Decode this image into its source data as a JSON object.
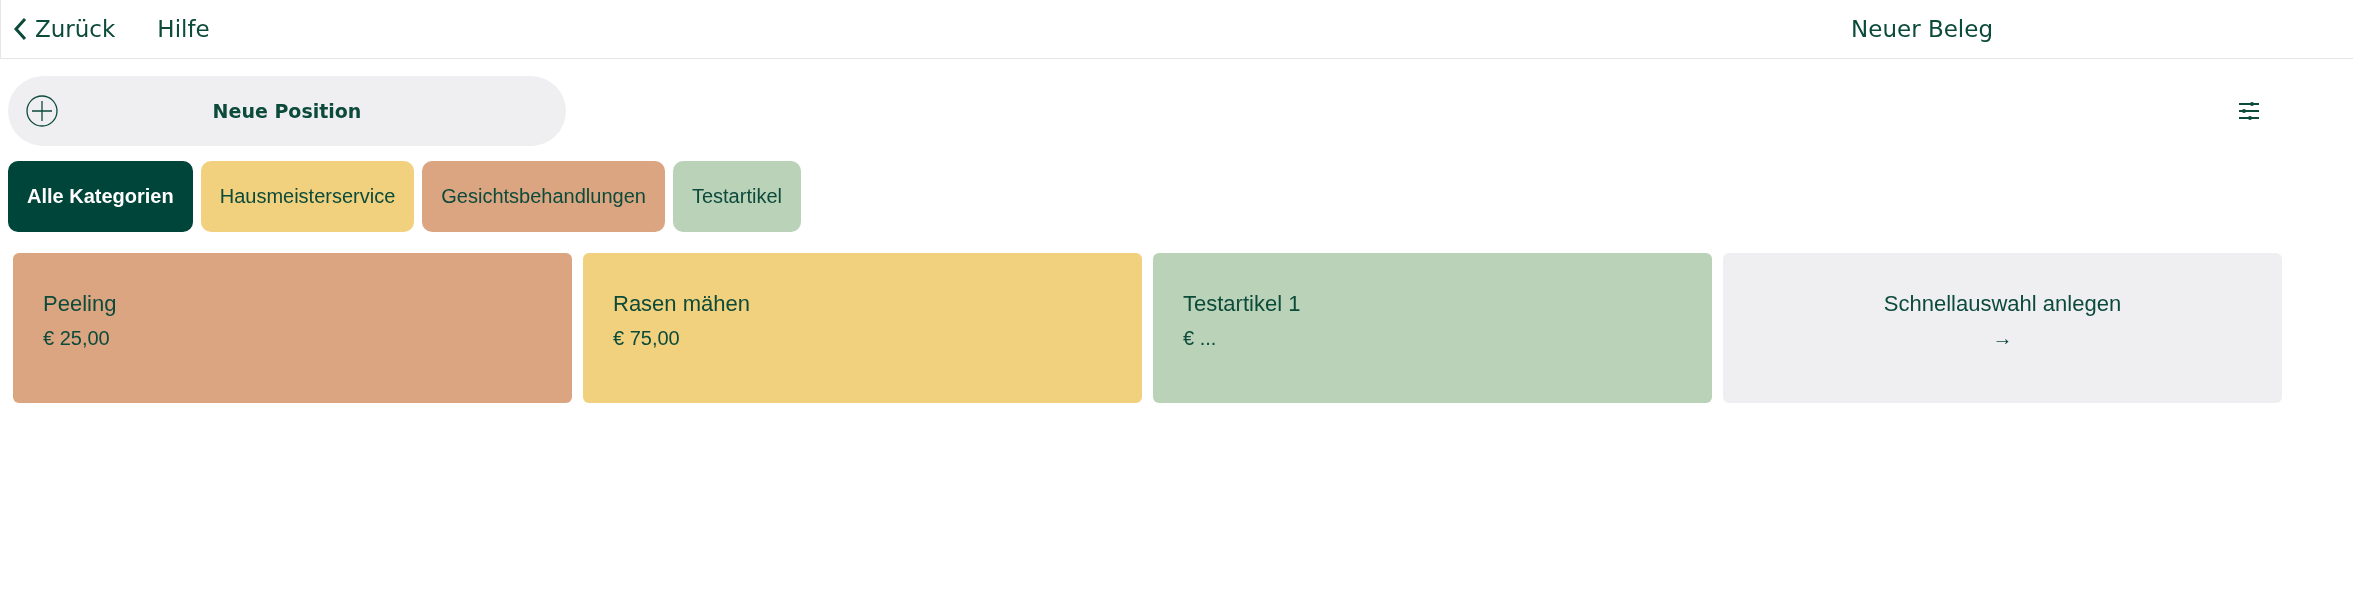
{
  "header": {
    "back": "Zurück",
    "help": "Hilfe",
    "title": "Neuer Beleg"
  },
  "new_position": {
    "label": "Neue Position"
  },
  "categories": [
    {
      "label": "Alle Kategorien",
      "selected": true,
      "color": "#004539"
    },
    {
      "label": "Hausmeisterservice",
      "selected": false,
      "color": "#f1d17d"
    },
    {
      "label": "Gesichtsbehandlungen",
      "selected": false,
      "color": "#dba582"
    },
    {
      "label": "Testartikel",
      "selected": false,
      "color": "#bad2b8"
    }
  ],
  "items": [
    {
      "kind": "product",
      "name": "Peeling",
      "price": "€ 25,00",
      "color": "#dba582"
    },
    {
      "kind": "product",
      "name": "Rasen mähen",
      "price": "€ 75,00",
      "color": "#f1d17d"
    },
    {
      "kind": "product",
      "name": "Testartikel 1",
      "price": "€ ...",
      "color": "#bad2b8"
    },
    {
      "kind": "create",
      "name": "Schnellauswahl anlegen",
      "price": "→",
      "color": "#efeff1"
    }
  ]
}
